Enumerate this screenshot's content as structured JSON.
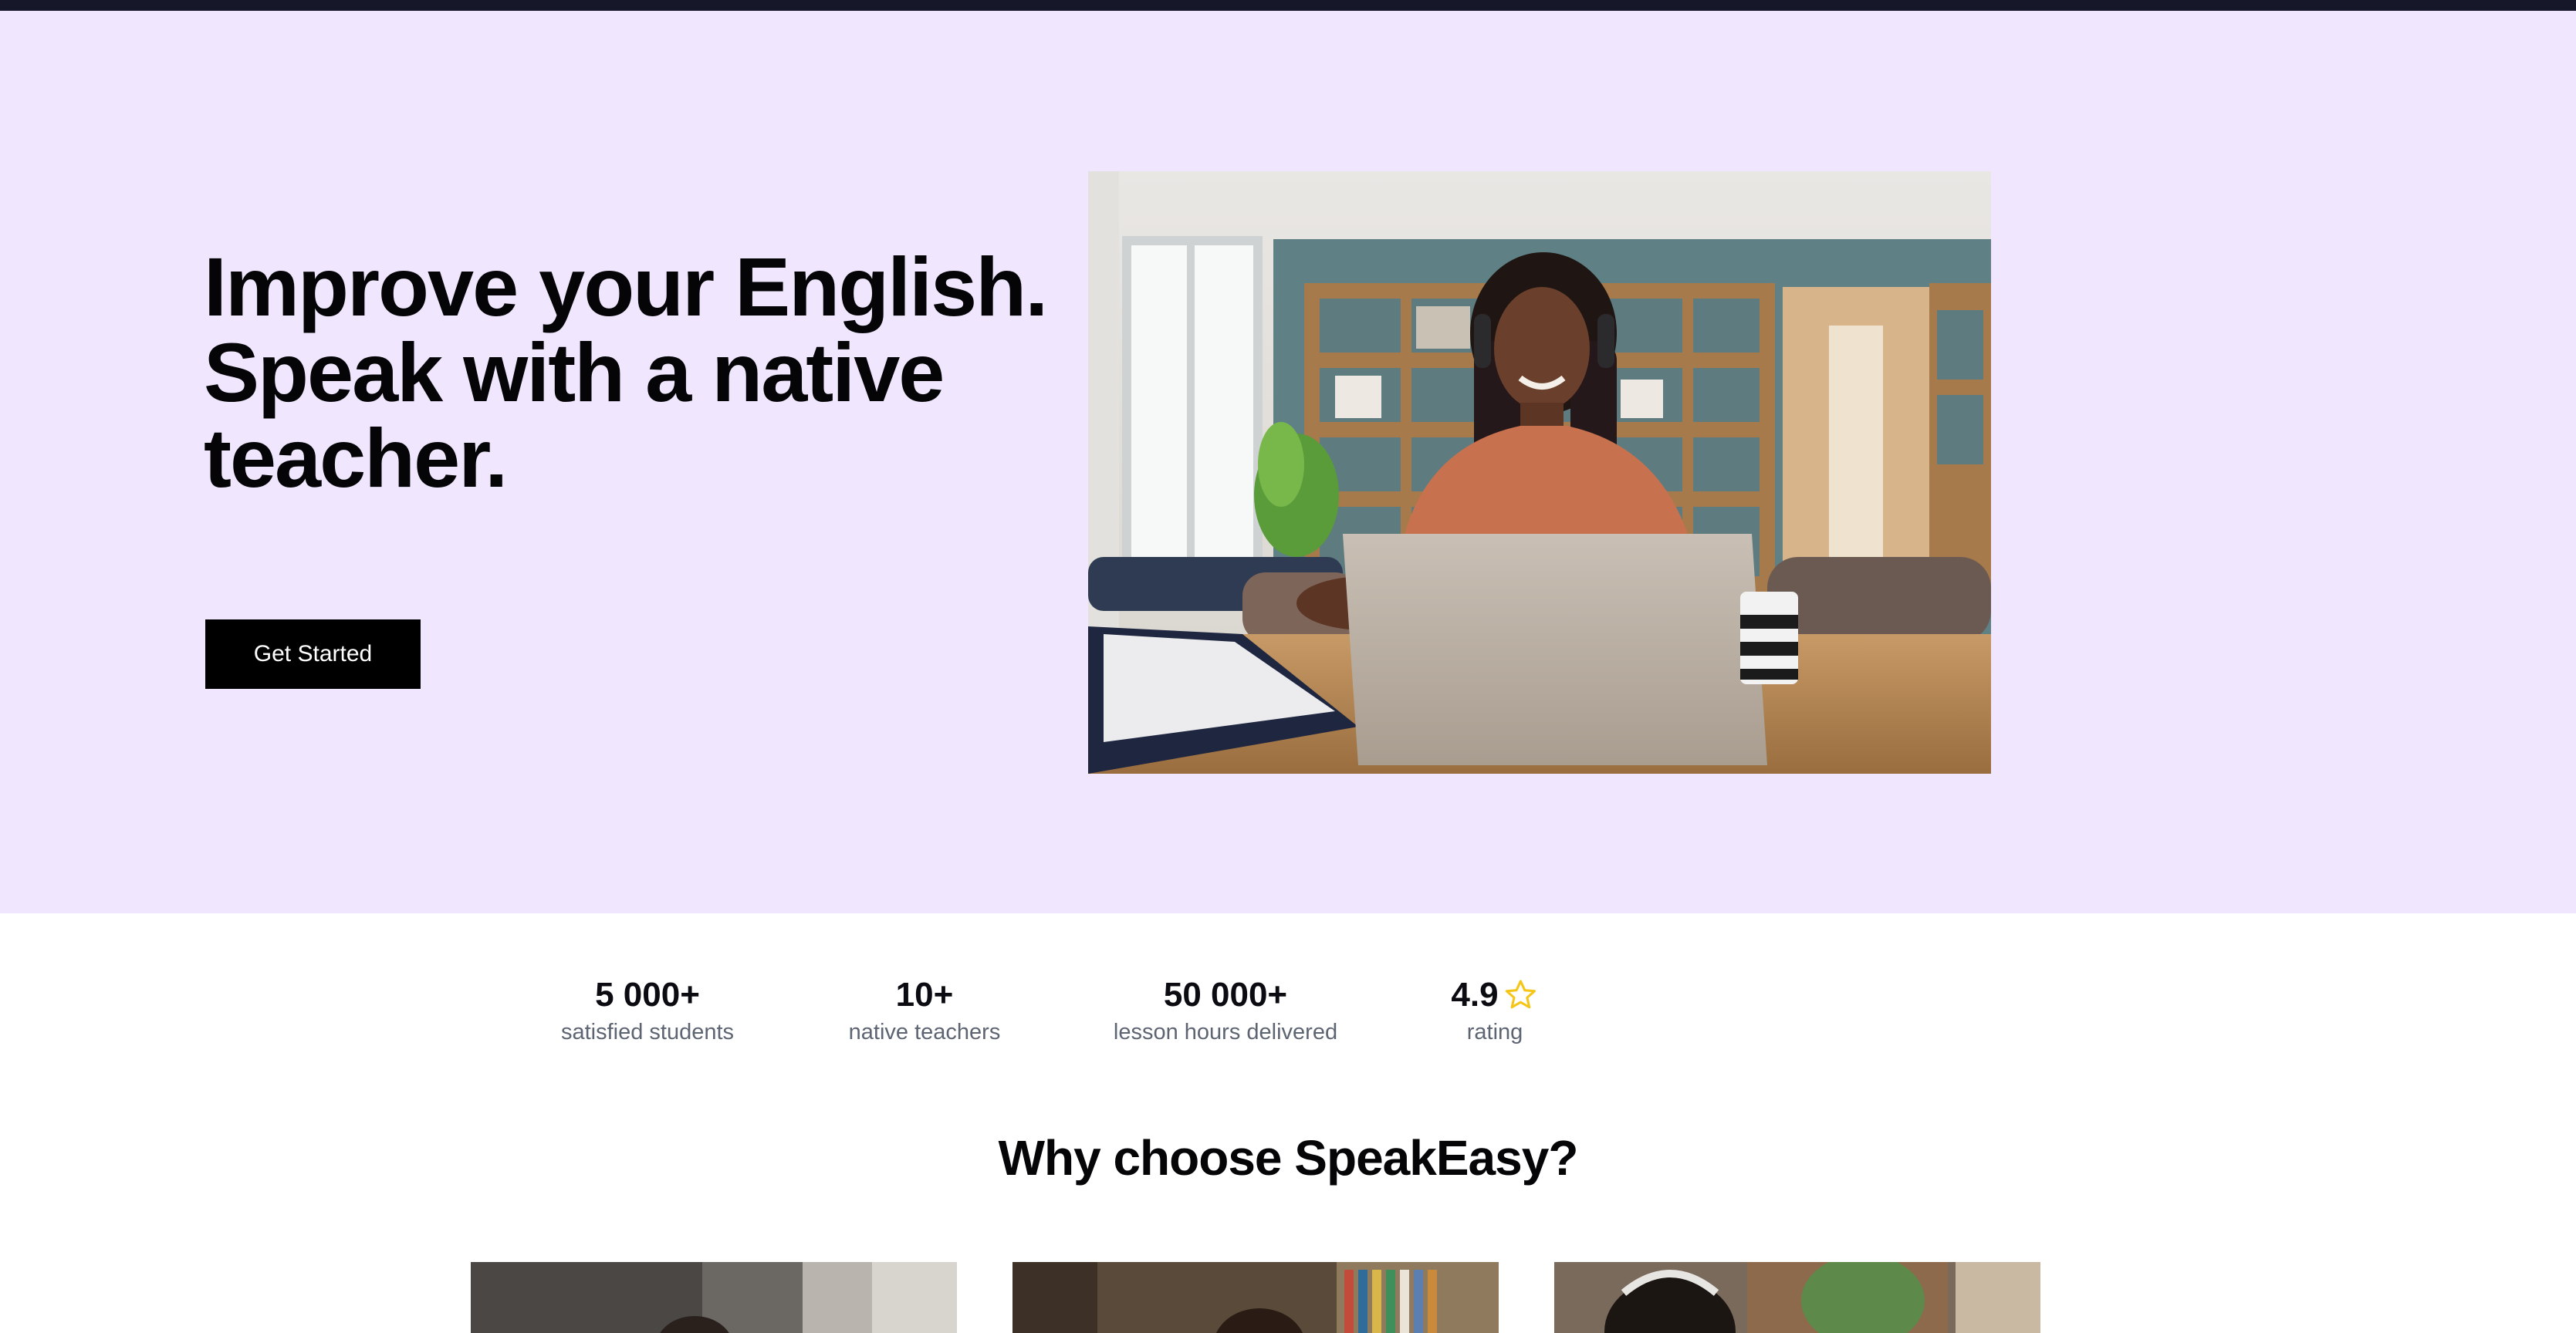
{
  "hero": {
    "title_lines": [
      "Improve your English.",
      "Speak with a native",
      "teacher."
    ],
    "cta_label": "Get Started",
    "background": "#f0e7fe"
  },
  "stats": [
    {
      "value": "5 000+",
      "label": "satisfied students"
    },
    {
      "value": "10+",
      "label": "native teachers"
    },
    {
      "value": "50 000+",
      "label": "lesson hours delivered"
    },
    {
      "value": "4.9",
      "label": "rating",
      "icon": "star-icon"
    }
  ],
  "features": {
    "title": "Why choose SpeakEasy?"
  },
  "colors": {
    "topbar": "#161729",
    "cta": "#000000",
    "star": "#f5c518",
    "muted_text": "#5d6472"
  }
}
